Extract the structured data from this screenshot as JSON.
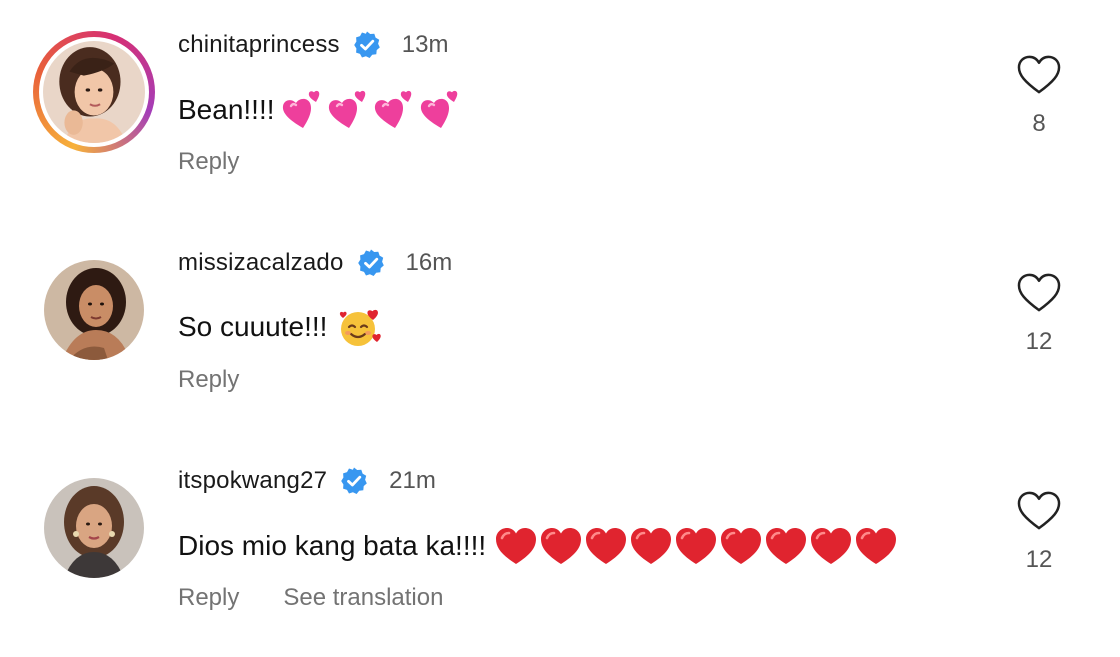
{
  "comments": [
    {
      "username": "chinitaprincess",
      "time": "13m",
      "text": "Bean!!!!",
      "emoji": "sparkling-pink-hearts",
      "emoji_count": 4,
      "reply_label": "Reply",
      "likes": "8",
      "has_story_ring": true
    },
    {
      "username": "missizacalzado",
      "time": "16m",
      "text": "So cuuute!!!",
      "emoji": "smiling-face-with-hearts",
      "emoji_count": 1,
      "reply_label": "Reply",
      "likes": "12",
      "has_story_ring": false
    },
    {
      "username": "itspokwang27",
      "time": "21m",
      "text": "Dios mio kang bata ka!!!!",
      "emoji": "red-heart",
      "emoji_count": 9,
      "reply_label": "Reply",
      "translation_label": "See translation",
      "likes": "12",
      "has_story_ring": false
    }
  ],
  "colors": {
    "verified_badge": "#3897f0",
    "heart_emoji_red": "#e0242f",
    "heart_emoji_pink": "#ee3f9c",
    "secondary_text": "#737373"
  }
}
